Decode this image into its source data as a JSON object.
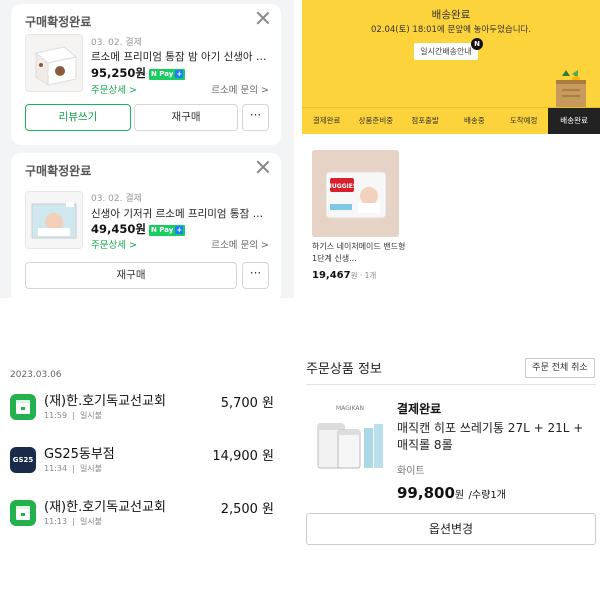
{
  "purchase_orders": [
    {
      "title": "구매확정완료",
      "date": "03. 02. 결제",
      "product_name": "르소메 프리미엄 통잠 밤 아기 신생아 밤...",
      "price": "95,250원",
      "npay_label": "N Pay",
      "detail_link": "주문상세 >",
      "inquiry_link": "르소메 문의 >",
      "review_button": "리뷰쓰기",
      "rebuy_button": "재구매",
      "more_button": "···"
    },
    {
      "title": "구매확정완료",
      "date": "03. 02. 결제",
      "product_name": "신생아 기저귀 르소메 프리미엄 통잠 밤 ...",
      "price": "49,450원",
      "npay_label": "N Pay",
      "detail_link": "주문상세 >",
      "inquiry_link": "르소메 문의 >",
      "rebuy_button": "재구매",
      "more_button": "···"
    }
  ],
  "delivery": {
    "title": "배송완료",
    "message": "02.04(토) 18:01에 문앞에 놓아두었습니다.",
    "info_button": "일시간배송안내",
    "badge": "N",
    "tabs": [
      "결제완료",
      "상품준비중",
      "점포출발",
      "배송중",
      "도착예정",
      "배송완료"
    ],
    "active_tab": "배송완료",
    "product_brand_text": "HUGGIES",
    "product_name": "하기스 네이처메이드 밴드형 1단계 신생...",
    "price": "19,467",
    "price_suffix": "원 · 1개"
  },
  "transactions": {
    "date": "2023.03.06",
    "items": [
      {
        "icon": "store-icon",
        "name": "(재)한.호기독교선교회",
        "time": "11:59",
        "type": "일시불",
        "amount": "5,700 원"
      },
      {
        "icon": "gs25-icon",
        "icon_text": "GS25",
        "name": "GS25동부점",
        "time": "11:34",
        "type": "일시불",
        "amount": "14,900 원"
      },
      {
        "icon": "store-icon",
        "name": "(재)한.호기독교선교회",
        "time": "11:13",
        "type": "일시불",
        "amount": "2,500 원"
      }
    ]
  },
  "order_info": {
    "title": "주문상품 정보",
    "cancel_all": "주문 전체 취소",
    "brand_label": "MAGIKAN",
    "status": "결제완료",
    "product_name": "매직캔 히포 쓰레기통 27L + 21L + 매직롤 8롤",
    "option": "화이트",
    "price": "99,800",
    "price_unit": "원",
    "quantity": "/수량1개",
    "change_option_button": "옵션변경"
  },
  "colors": {
    "npay_green": "#19ce60",
    "delivery_yellow": "#fcd33a",
    "store_green": "#23b14d",
    "gs25_navy": "#1a2a4a"
  }
}
